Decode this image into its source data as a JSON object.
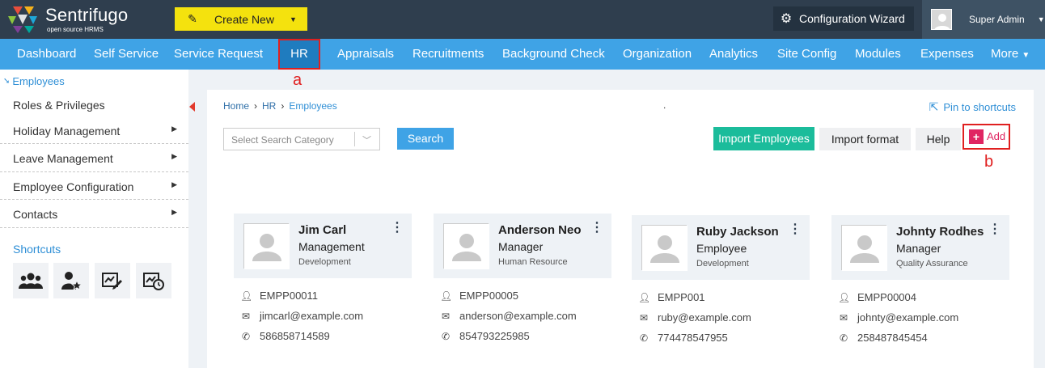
{
  "brand": {
    "name": "Sentrifugo",
    "tagline": "open source HRMS"
  },
  "header": {
    "create_label": "Create New",
    "config_label": "Configuration Wizard",
    "user_name": "Super Admin"
  },
  "nav": {
    "items": [
      "Dashboard",
      "Self Service",
      "Service Request",
      "HR",
      "Appraisals",
      "Recruitments",
      "Background Check",
      "Organization",
      "Analytics",
      "Site Config",
      "Modules",
      "Expenses",
      "More"
    ],
    "active": "HR"
  },
  "annotations": {
    "a": "a",
    "b": "b"
  },
  "sidebar": {
    "active": "Employees",
    "items": [
      "Roles & Privileges",
      "Holiday Management",
      "Leave Management",
      "Employee Configuration",
      "Contacts"
    ],
    "shortcuts_title": "Shortcuts",
    "shortcut_icons": [
      "team-icon",
      "user-star-icon",
      "approval-edit-icon",
      "approval-clock-icon"
    ]
  },
  "breadcrumb": {
    "home": "Home",
    "sep": "›",
    "hr": "HR",
    "current": "Employees"
  },
  "dot": ".",
  "pin_label": "Pin to shortcuts",
  "search": {
    "placeholder": "Select Search Category",
    "button": "Search"
  },
  "actions": {
    "import": "Import Employees",
    "format": "Import format",
    "help": "Help",
    "add": "Add"
  },
  "employees": [
    {
      "name": "Jim Carl",
      "role": "Management",
      "dept": "Development",
      "id": "EMPP00011",
      "email": "jimcarl@example.com",
      "phone": "586858714589"
    },
    {
      "name": "Anderson Neo",
      "role": "Manager",
      "dept": "Human Resource",
      "id": "EMPP00005",
      "email": "anderson@example.com",
      "phone": "854793225985"
    },
    {
      "name": "Ruby Jackson",
      "role": "Employee",
      "dept": "Development",
      "id": "EMPP001",
      "email": "ruby@example.com",
      "phone": "774478547955"
    },
    {
      "name": "Johnty Rodhes",
      "role": "Manager",
      "dept": "Quality Assurance",
      "id": "EMPP00004",
      "email": "johnty@example.com",
      "phone": "258487845454"
    }
  ],
  "colors": {
    "header": "#2f3e4e",
    "nav": "#3fa3e6",
    "nav_active": "#1f7cbf",
    "accent_yellow": "#f4e20e",
    "import_green": "#1bbc9b",
    "add_pink": "#e02562",
    "annotation_red": "#e02020"
  }
}
